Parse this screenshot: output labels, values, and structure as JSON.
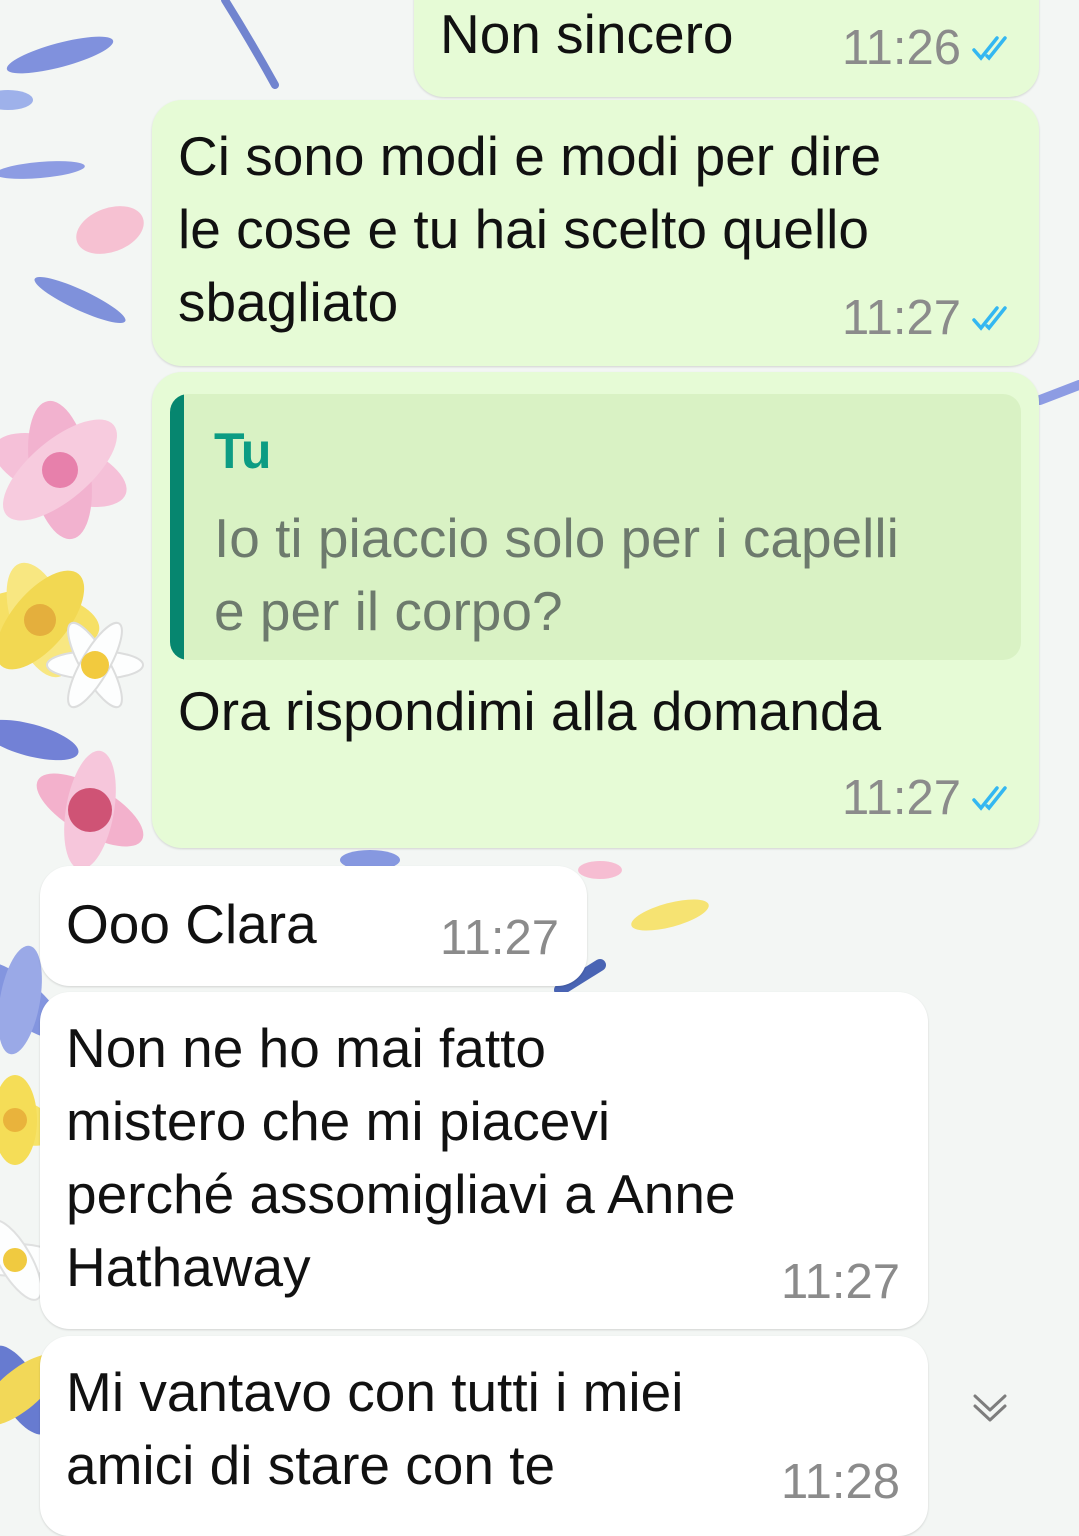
{
  "messages": [
    {
      "direction": "outgoing",
      "text": "Non sincero",
      "time": "11:26",
      "status": "read"
    },
    {
      "direction": "outgoing",
      "text": "Ci sono modi e modi per dire\nle cose e tu hai scelto quello\nsbagliato",
      "time": "11:27",
      "status": "read"
    },
    {
      "direction": "outgoing",
      "reply_to": {
        "author": "Tu",
        "text": "Io ti piaccio solo per i capelli\ne per il corpo?"
      },
      "text": "Ora rispondimi alla domanda",
      "time": "11:27",
      "status": "read"
    },
    {
      "direction": "incoming",
      "text": "Ooo Clara",
      "time": "11:27"
    },
    {
      "direction": "incoming",
      "text": "Non ne ho mai fatto\nmistero che mi piacevi\nperché assomigliavi a Anne\nHathaway",
      "time": "11:27"
    },
    {
      "direction": "incoming",
      "text": "Mi vantavo con tutti i miei\namici di stare con te",
      "time": "11:28"
    }
  ],
  "icons": {
    "read_ticks": "double-check-icon",
    "scroll_down": "chevron-double-down-icon"
  },
  "colors": {
    "outgoing_bubble": "#e6fbd6",
    "incoming_bubble": "#ffffff",
    "read_ticks": "#34b7f1",
    "quote_bar": "#06866f",
    "quote_author": "#0c9c83"
  }
}
